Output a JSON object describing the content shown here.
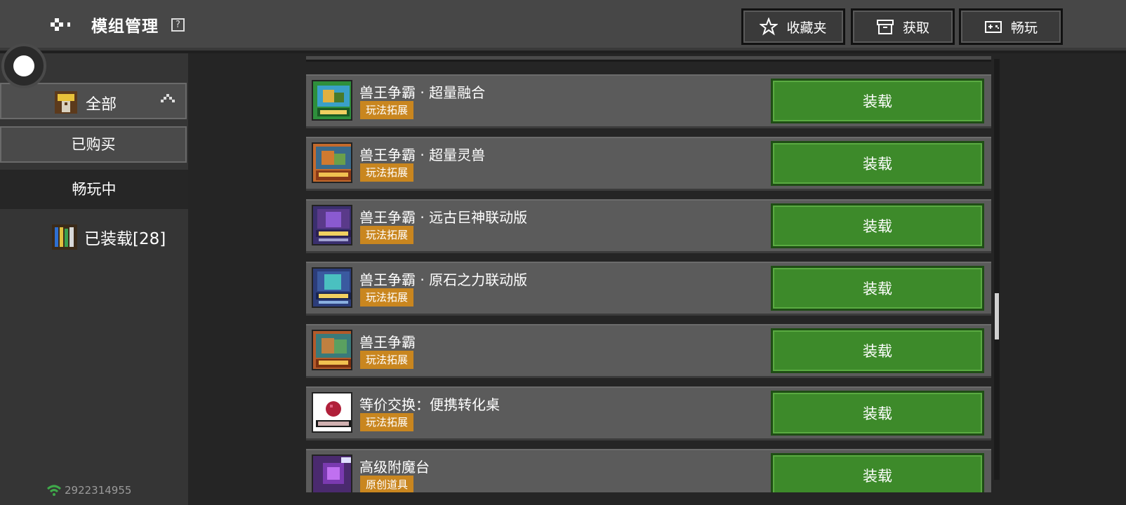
{
  "header": {
    "title": "模组管理",
    "help_glyph": "?",
    "buttons": [
      {
        "label": "收藏夹",
        "icon": "star-icon"
      },
      {
        "label": "获取",
        "icon": "box-icon"
      },
      {
        "label": "畅玩",
        "icon": "gamepad-icon"
      }
    ]
  },
  "sidebar": {
    "category_all": "全部",
    "purchased": "已购买",
    "playing": "畅玩中",
    "installed": "已装载[28]",
    "account_id": "2922314955"
  },
  "mods": [
    {
      "name": "兽王争霸 · 超量融合",
      "tag": "玩法拓展",
      "button": "装载",
      "thumb_color": "#2e8f3c"
    },
    {
      "name": "兽王争霸 · 超量灵兽",
      "tag": "玩法拓展",
      "button": "装载",
      "thumb_color": "#c46a2c"
    },
    {
      "name": "兽王争霸 · 远古巨神联动版",
      "tag": "玩法拓展",
      "button": "装载",
      "thumb_color": "#3a2f6e"
    },
    {
      "name": "兽王争霸 · 原石之力联动版",
      "tag": "玩法拓展",
      "button": "装载",
      "thumb_color": "#2c3d7a"
    },
    {
      "name": "兽王争霸",
      "tag": "玩法拓展",
      "button": "装载",
      "thumb_color": "#b45a2a"
    },
    {
      "name": "等价交换：便携转化桌",
      "tag": "玩法拓展",
      "button": "装载",
      "thumb_color": "#ffffff"
    },
    {
      "name": "高级附魔台",
      "tag": "原创道具",
      "button": "装载",
      "thumb_color": "#4a2a6e"
    }
  ],
  "colors": {
    "load_button": "#3d8a2a",
    "tag": "#c9861f",
    "row": "#5b5b5b"
  }
}
